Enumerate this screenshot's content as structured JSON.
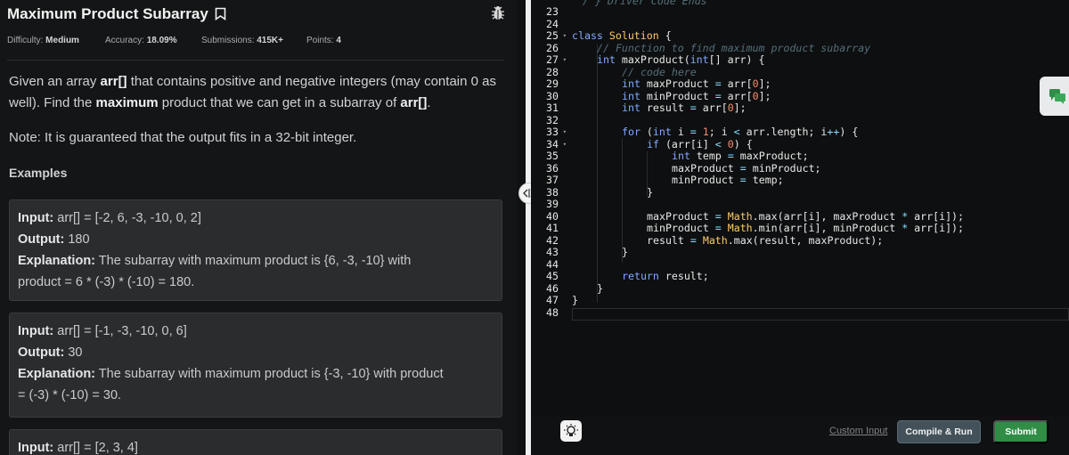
{
  "problem": {
    "title": "Maximum Product Subarray",
    "difficulty_label": "Difficulty:",
    "difficulty": "Medium",
    "accuracy_label": "Accuracy:",
    "accuracy": "18.09%",
    "submissions_label": "Submissions:",
    "submissions": "415K+",
    "points_label": "Points:",
    "points": "4",
    "desc_p1": "Given an array ",
    "desc_arr": "arr[]",
    "desc_p2": " that contains positive and negative integers (may contain 0 as well). Find the ",
    "desc_max": "maximum",
    "desc_p3": " product that we can get in a subarray of ",
    "desc_arr2": "arr[]",
    "desc_p4": ".",
    "note": "Note: It is guaranteed that the output fits in a 32-bit integer.",
    "examples_title": "Examples"
  },
  "examples": [
    {
      "input_label": "Input:",
      "input": " arr[] = [-2, 6, -3, -10, 0, 2]",
      "output_label": "Output:",
      "output": " 180",
      "explanation_label": "Explanation:",
      "explanation_1": " The subarray with maximum product is {6, -3, -10} with",
      "explanation_2": "product = 6 * (-3) * (-10) = 180."
    },
    {
      "input_label": "Input:",
      "input": " arr[] = [-1, -3, -10, 0, 6]",
      "output_label": "Output:",
      "output": " 30",
      "explanation_label": "Explanation:",
      "explanation_1": " The subarray with maximum product is {-3, -10} with product",
      "explanation_2": "= (-3) * (-10) = 30."
    },
    {
      "input_label": "Input:",
      "input": " arr[] = [2, 3, 4]"
    }
  ],
  "editor": {
    "top_faded": "/ } Driver Code Ends",
    "line_numbers": [
      "23",
      "24",
      "25",
      "26",
      "27",
      "28",
      "29",
      "30",
      "31",
      "32",
      "33",
      "34",
      "35",
      "36",
      "37",
      "38",
      "39",
      "40",
      "41",
      "42",
      "43",
      "44",
      "45",
      "46",
      "47",
      "48"
    ]
  },
  "code_lines": {
    "l25a": "class ",
    "l25b": "Solution",
    "l25c": " {",
    "l26": "// Function to find maximum product subarray",
    "l27a": "int ",
    "l27b": "maxProduct(",
    "l27c": "int",
    "l27d": "[] arr) {",
    "l28": "// code here",
    "l29a": "int ",
    "l29b": "maxProduct ",
    "l29c": "=",
    "l29d": " arr[",
    "l29e": "0",
    "l29f": "];",
    "l30a": "int ",
    "l30b": "minProduct ",
    "l30c": "=",
    "l30d": " arr[",
    "l30e": "0",
    "l30f": "];",
    "l31a": "int ",
    "l31b": "result ",
    "l31c": "=",
    "l31d": " arr[",
    "l31e": "0",
    "l31f": "];",
    "l33a": "for ",
    "l33b": "(",
    "l33c": "int ",
    "l33d": "i ",
    "l33e": "=",
    "l33f": " ",
    "l33g": "1",
    "l33h": "; i ",
    "l33i": "<",
    "l33j": " arr.length; i",
    "l33k": "++",
    "l33l": ") {",
    "l34a": "if ",
    "l34b": "(arr[i] ",
    "l34c": "<",
    "l34d": " ",
    "l34e": "0",
    "l34f": ") {",
    "l35a": "int ",
    "l35b": "temp ",
    "l35c": "=",
    "l35d": " maxProduct;",
    "l36a": "maxProduct ",
    "l36b": "=",
    "l36c": " minProduct;",
    "l37a": "minProduct ",
    "l37b": "=",
    "l37c": " temp;",
    "l38": "}",
    "l40a": "maxProduct ",
    "l40b": "=",
    "l40c": " Math",
    "l40d": ".max(arr[i], maxProduct ",
    "l40e": "*",
    "l40f": " arr[i]);",
    "l41a": "minProduct ",
    "l41b": "=",
    "l41c": " Math",
    "l41d": ".min(arr[i], minProduct ",
    "l41e": "*",
    "l41f": " arr[i]);",
    "l42a": "result ",
    "l42b": "=",
    "l42c": " Math",
    "l42d": ".max(result, maxProduct);",
    "l43": "}",
    "l45a": "return ",
    "l45b": "result;",
    "l46": "}",
    "l47": "}"
  },
  "actions": {
    "custom_input": "Custom Input",
    "compile_run": "Compile & Run",
    "submit": "Submit"
  },
  "colors": {
    "submit_bg": "#2f8d46",
    "compile_bg": "#43525a",
    "keyword": "#82aaff",
    "comment": "#546e7a",
    "number": "#f78c6c"
  },
  "icons": [
    "bookmark-icon",
    "bug-report-icon",
    "drag-handle-icon",
    "chat-icon",
    "lightbulb-icon",
    "fold-arrow-icon"
  ]
}
